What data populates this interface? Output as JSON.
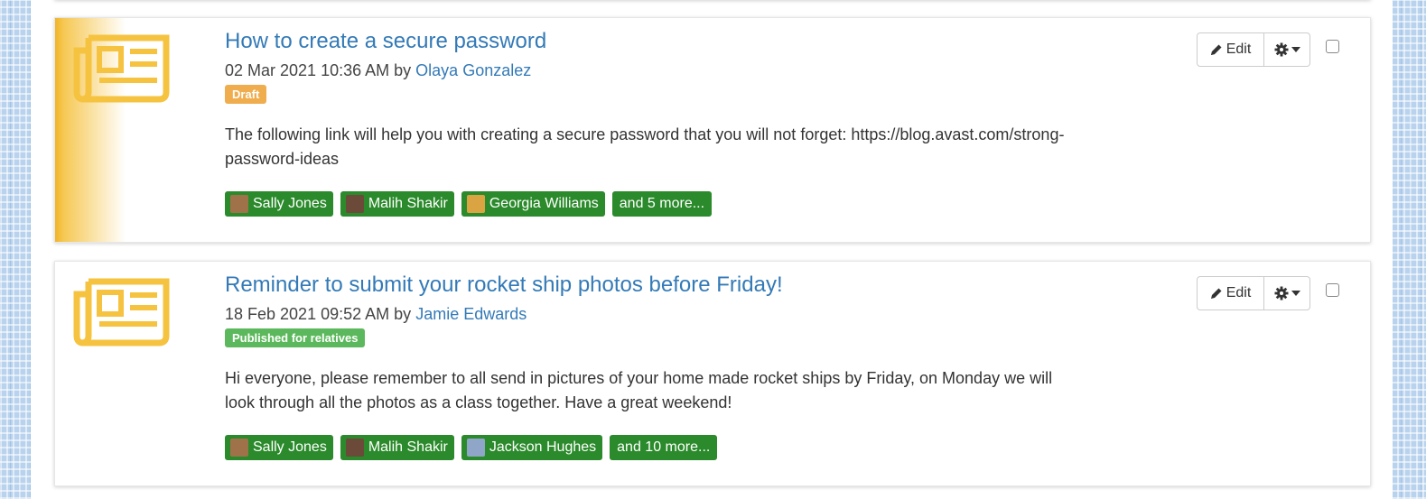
{
  "actions": {
    "edit_label": "Edit"
  },
  "posts": [
    {
      "title": "How to create a secure password",
      "date": "02 Mar 2021 10:36 AM",
      "by": "by",
      "author": "Olaya Gonzalez",
      "status": "Draft",
      "status_color": "#f0ad4e",
      "description": "The following link will help you with creating a secure password that you will not forget: https://blog.avast.com/strong-password-ideas",
      "recipients": [
        {
          "name": "Sally Jones",
          "avatar_color": "#a0724a"
        },
        {
          "name": "Malih Shakir",
          "avatar_color": "#6b4a3a"
        },
        {
          "name": "Georgia Williams",
          "avatar_color": "#d9a441"
        }
      ],
      "more_label": "and 5 more..."
    },
    {
      "title": "Reminder to submit your rocket ship photos before Friday!",
      "date": "18 Feb 2021 09:52 AM",
      "by": "by",
      "author": "Jamie Edwards",
      "status": "Published for relatives",
      "status_color": "#5cb85c",
      "description": "Hi everyone, please remember to all send in pictures of your home made rocket ships by Friday, on Monday we will look through all the photos as a class together. Have a great weekend!",
      "recipients": [
        {
          "name": "Sally Jones",
          "avatar_color": "#a0724a"
        },
        {
          "name": "Malih Shakir",
          "avatar_color": "#6b4a3a"
        },
        {
          "name": "Jackson Hughes",
          "avatar_color": "#8fa6c8"
        }
      ],
      "more_label": "and 10 more..."
    }
  ],
  "colors": {
    "accent": "#f0b429",
    "link": "#337ab7",
    "tag_bg": "#2b8a2b",
    "icon": "#f6c340"
  },
  "icons": {
    "post_icon": "newspaper-icon",
    "edit_icon": "pencil-icon",
    "menu_icon": "gear-icon"
  }
}
